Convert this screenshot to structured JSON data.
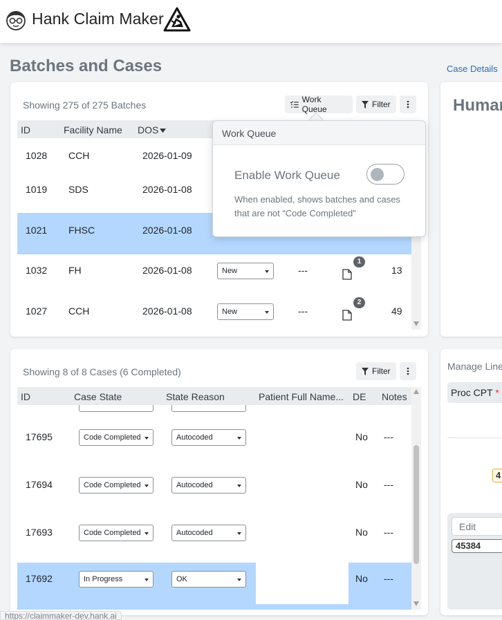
{
  "app": {
    "title": "Hank Claim Maker"
  },
  "page": {
    "title": "Batches and Cases",
    "case_details_link": "Case Details"
  },
  "batches": {
    "count_text": "Showing 275 of 275 Batches",
    "toolbar": {
      "work_queue": "Work Queue",
      "filter": "Filter"
    },
    "columns": [
      "ID",
      "Facility Name",
      "DOS"
    ],
    "rows": [
      {
        "id": "1028",
        "facility": "CCH",
        "dos": "2026-01-09"
      },
      {
        "id": "1019",
        "facility": "SDS",
        "dos": "2026-01-08"
      },
      {
        "id": "1021",
        "facility": "FHSC",
        "dos": "2026-01-08"
      },
      {
        "id": "1032",
        "facility": "FH",
        "dos": "2026-01-08",
        "status": "New",
        "reason": "---",
        "badge": "1",
        "count": "13"
      },
      {
        "id": "1027",
        "facility": "CCH",
        "dos": "2026-01-08",
        "status": "New",
        "reason": "---",
        "badge": "2",
        "count": "49"
      }
    ]
  },
  "popover": {
    "title": "Work Queue",
    "toggle_label": "Enable Work Queue",
    "toggle_on": false,
    "help": "When enabled, shows batches and cases that are not “Code Completed”"
  },
  "cases": {
    "count_text": "Showing 8 of 8 Cases (6 Completed)",
    "toolbar": {
      "filter": "Filter"
    },
    "columns": [
      "ID",
      "Case State",
      "State Reason",
      "Patient Full Name...",
      "DE",
      "Notes"
    ],
    "rows": [
      {
        "id": "17695",
        "state": "Code Completed",
        "reason": "Autocoded",
        "de": "No",
        "notes": "---"
      },
      {
        "id": "17694",
        "state": "Code Completed",
        "reason": "Autocoded",
        "de": "No",
        "notes": "---"
      },
      {
        "id": "17693",
        "state": "Code Completed",
        "reason": "Autocoded",
        "de": "No",
        "notes": "---"
      },
      {
        "id": "17692",
        "state": "In Progress",
        "reason": "OK",
        "de": "No",
        "notes": "---"
      }
    ]
  },
  "right_panel": {
    "title": "Human",
    "manage_label": "Manage Line",
    "proc_cpt": "Proc CPT",
    "required_mark": "*",
    "chip_value": "4",
    "edit_placeholder": "Edit",
    "code_value": "45384"
  },
  "status_bar": {
    "url": "https://claimmaker-dev.hank.ai"
  },
  "colors": {
    "selected_row": "#b3d7ff",
    "link": "#2a6db0",
    "header_bg": "#e9ecef"
  }
}
